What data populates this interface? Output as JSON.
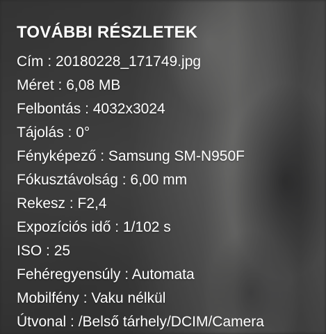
{
  "panel": {
    "title": "TOVÁBBI RÉSZLETEK",
    "separator": " : ",
    "rows": [
      {
        "label": "Cím",
        "value": "20180228_171749.jpg"
      },
      {
        "label": "Méret",
        "value": "6,08 MB"
      },
      {
        "label": "Felbontás",
        "value": "4032x3024"
      },
      {
        "label": "Tájolás",
        "value": "0°"
      },
      {
        "label": "Fényképező",
        "value": "Samsung SM-N950F"
      },
      {
        "label": "Fókusztávolság",
        "value": "6,00 mm"
      },
      {
        "label": "Rekesz",
        "value": "F2,4"
      },
      {
        "label": "Expozíciós idő",
        "value": "1/102 s"
      },
      {
        "label": "ISO",
        "value": "25"
      },
      {
        "label": "Fehéregyensúly",
        "value": "Automata"
      },
      {
        "label": "Mobilfény",
        "value": "Vaku nélkül"
      },
      {
        "label": "Útvonal",
        "value": "/Belső tárhely/DCIM/Camera"
      }
    ]
  },
  "colors": {
    "text": "#ffffff",
    "overlay": "#000000"
  }
}
